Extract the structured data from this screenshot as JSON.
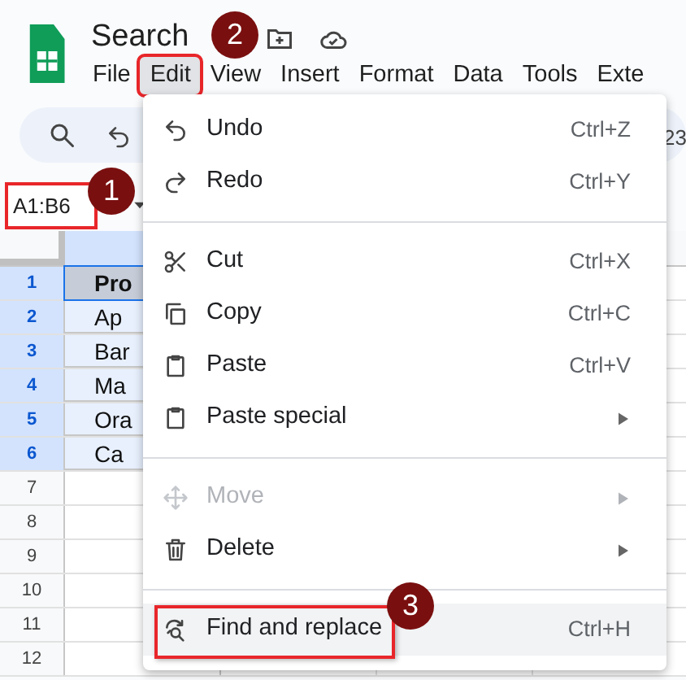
{
  "app": {
    "title": "Search"
  },
  "menu_bar": [
    {
      "label": "File",
      "selected": false,
      "outlined": false
    },
    {
      "label": "Edit",
      "selected": true,
      "outlined": true
    },
    {
      "label": "View",
      "selected": false,
      "outlined": false
    },
    {
      "label": "Insert",
      "selected": false,
      "outlined": false
    },
    {
      "label": "Format",
      "selected": false,
      "outlined": false
    },
    {
      "label": "Data",
      "selected": false,
      "outlined": false
    },
    {
      "label": "Tools",
      "selected": false,
      "outlined": false
    },
    {
      "label": "Exte",
      "selected": false,
      "outlined": false
    }
  ],
  "toolbar": {
    "trailing_text": "23"
  },
  "name_box": {
    "value": "A1:B6",
    "outlined": true
  },
  "sheet": {
    "rows": [
      {
        "number": "1",
        "cell": "Pro",
        "selected": true
      },
      {
        "number": "2",
        "cell": "Ap",
        "selected": true
      },
      {
        "number": "3",
        "cell": "Bar",
        "selected": true
      },
      {
        "number": "4",
        "cell": "Ma",
        "selected": true
      },
      {
        "number": "5",
        "cell": "Ora",
        "selected": true
      },
      {
        "number": "6",
        "cell": "Ca",
        "selected": true
      },
      {
        "number": "7",
        "selected": false
      },
      {
        "number": "8",
        "selected": false
      },
      {
        "number": "9",
        "selected": false
      },
      {
        "number": "10",
        "selected": false
      },
      {
        "number": "11",
        "selected": false
      },
      {
        "number": "12",
        "selected": false
      }
    ]
  },
  "edit_menu": {
    "items": [
      {
        "kind": "undo",
        "label": "Undo",
        "shortcut": "Ctrl+Z",
        "disabled": false,
        "submenu": false,
        "highlighted": false,
        "outlined": false
      },
      {
        "kind": "redo",
        "label": "Redo",
        "shortcut": "Ctrl+Y",
        "disabled": false,
        "submenu": false,
        "highlighted": false,
        "outlined": false
      },
      {
        "kind": "divider"
      },
      {
        "kind": "cut",
        "label": "Cut",
        "shortcut": "Ctrl+X",
        "disabled": false,
        "submenu": false,
        "highlighted": false,
        "outlined": false
      },
      {
        "kind": "copy",
        "label": "Copy",
        "shortcut": "Ctrl+C",
        "disabled": false,
        "submenu": false,
        "highlighted": false,
        "outlined": false
      },
      {
        "kind": "paste",
        "label": "Paste",
        "shortcut": "Ctrl+V",
        "disabled": false,
        "submenu": false,
        "highlighted": false,
        "outlined": false
      },
      {
        "kind": "paste",
        "label": "Paste special",
        "disabled": false,
        "submenu": true,
        "highlighted": false,
        "outlined": false
      },
      {
        "kind": "divider"
      },
      {
        "kind": "move",
        "label": "Move",
        "disabled": true,
        "submenu": true,
        "highlighted": false,
        "outlined": false
      },
      {
        "kind": "delete",
        "label": "Delete",
        "disabled": false,
        "submenu": true,
        "highlighted": false,
        "outlined": false
      },
      {
        "kind": "divider"
      },
      {
        "kind": "find",
        "label": "Find and replace",
        "shortcut": "Ctrl+H",
        "disabled": false,
        "submenu": false,
        "highlighted": true,
        "outlined": true
      }
    ]
  },
  "callouts": [
    {
      "number": "1"
    },
    {
      "number": "2"
    },
    {
      "number": "3"
    }
  ]
}
